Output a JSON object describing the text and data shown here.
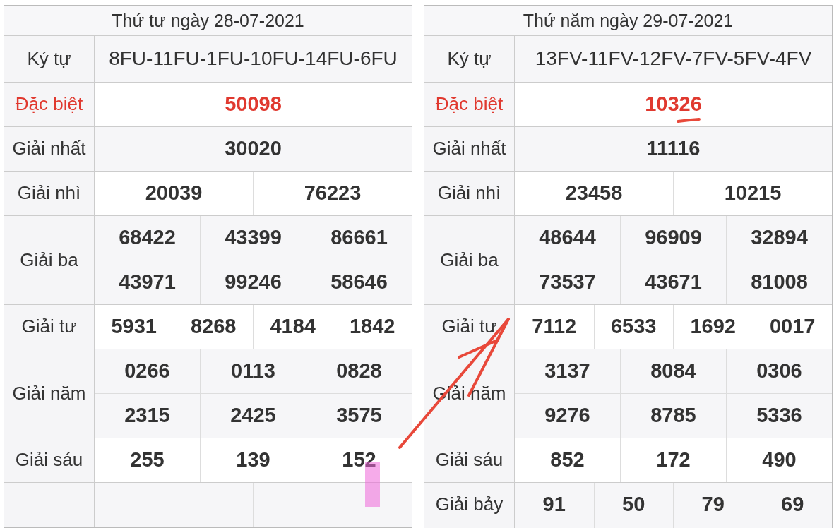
{
  "tables": [
    {
      "title": "Thứ tư ngày 28-07-2021",
      "rows": [
        {
          "label": "Ký tự",
          "kind": "code",
          "lines": [
            [
              "8FU-11FU-1FU-10FU-14FU-6FU"
            ]
          ]
        },
        {
          "label": "Đặc biệt",
          "kind": "special",
          "lines": [
            [
              "50098"
            ]
          ]
        },
        {
          "label": "Giải nhất",
          "kind": "normal",
          "lines": [
            [
              "30020"
            ]
          ]
        },
        {
          "label": "Giải nhì",
          "kind": "normal",
          "lines": [
            [
              "20039",
              "76223"
            ]
          ]
        },
        {
          "label": "Giải ba",
          "kind": "normal",
          "lines": [
            [
              "68422",
              "43399",
              "86661"
            ],
            [
              "43971",
              "99246",
              "58646"
            ]
          ]
        },
        {
          "label": "Giải tư",
          "kind": "normal",
          "lines": [
            [
              "5931",
              "8268",
              "4184",
              "1842"
            ]
          ]
        },
        {
          "label": "Giải năm",
          "kind": "normal",
          "lines": [
            [
              "0266",
              "0113",
              "0828"
            ],
            [
              "2315",
              "2425",
              "3575"
            ]
          ]
        },
        {
          "label": "Giải sáu",
          "kind": "normal",
          "lines": [
            [
              "255",
              "139",
              "152"
            ]
          ]
        }
      ]
    },
    {
      "title": "Thứ năm ngày 29-07-2021",
      "rows": [
        {
          "label": "Ký tự",
          "kind": "code",
          "lines": [
            [
              "13FV-11FV-12FV-7FV-5FV-4FV"
            ]
          ]
        },
        {
          "label": "Đặc biệt",
          "kind": "special",
          "lines": [
            [
              "10326"
            ]
          ]
        },
        {
          "label": "Giải nhất",
          "kind": "normal",
          "lines": [
            [
              "11116"
            ]
          ]
        },
        {
          "label": "Giải nhì",
          "kind": "normal",
          "lines": [
            [
              "23458",
              "10215"
            ]
          ]
        },
        {
          "label": "Giải ba",
          "kind": "normal",
          "lines": [
            [
              "48644",
              "96909",
              "32894"
            ],
            [
              "73537",
              "43671",
              "81008"
            ]
          ]
        },
        {
          "label": "Giải tư",
          "kind": "normal",
          "lines": [
            [
              "7112",
              "6533",
              "1692",
              "0017"
            ]
          ]
        },
        {
          "label": "Giải năm",
          "kind": "normal",
          "lines": [
            [
              "3137",
              "8084",
              "0306"
            ],
            [
              "9276",
              "8785",
              "5336"
            ]
          ]
        },
        {
          "label": "Giải sáu",
          "kind": "normal",
          "lines": [
            [
              "852",
              "172",
              "490"
            ]
          ]
        },
        {
          "label": "Giải bảy",
          "kind": "normal",
          "lines": [
            [
              "91",
              "50",
              "79",
              "69"
            ]
          ]
        }
      ]
    }
  ],
  "annotations": [
    {
      "kind": "arrow"
    },
    {
      "kind": "underline"
    },
    {
      "kind": "highlight"
    }
  ]
}
